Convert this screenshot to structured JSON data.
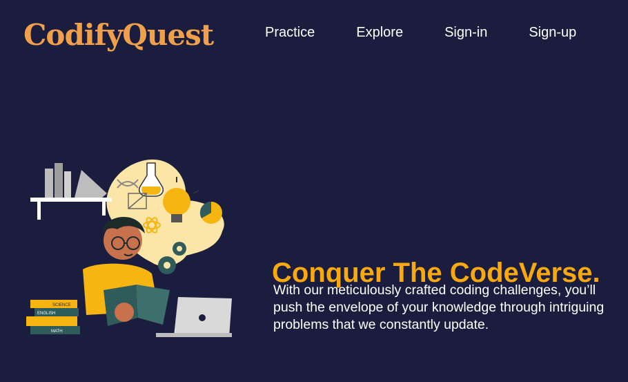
{
  "brand": {
    "name": "CodifyQuest",
    "color": "#f0a04b"
  },
  "nav": {
    "items": [
      {
        "label": "Practice"
      },
      {
        "label": "Explore"
      },
      {
        "label": "Sign-in"
      },
      {
        "label": "Sign-up"
      }
    ]
  },
  "hero": {
    "headline": "Conquer The CodeVerse.",
    "description": "With our meticulously crafted coding challenges, you’ll push the envelope of your knowledge through intriguing problems that we constantly update.",
    "illustration": {
      "books": [
        "SCIENCE",
        "ENGLISH",
        "MATH"
      ]
    }
  },
  "colors": {
    "background": "#1b1d3f",
    "accent": "#f7a90f"
  }
}
